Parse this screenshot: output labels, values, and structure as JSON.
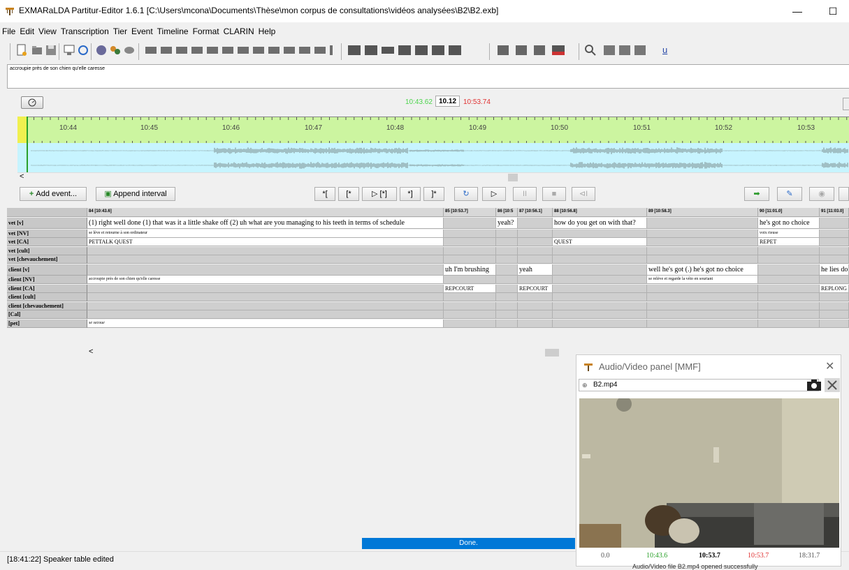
{
  "window": {
    "title": "EXMARaLDA Partitur-Editor 1.6.1 [C:\\Users\\mcona\\Documents\\Thèse\\mon corpus de consultations\\vidéos analysées\\B2\\B2.exb]",
    "minimize": "—",
    "maximize": "☐"
  },
  "menu": [
    "File",
    "Edit",
    "View",
    "Transcription",
    "Tier",
    "Event",
    "Timeline",
    "Format",
    "CLARIN",
    "Help"
  ],
  "description_text": "accroupie près de son chien qu'elle caresse",
  "time": {
    "start": "10:43.62",
    "duration": "10.12",
    "end": "10:53.74"
  },
  "ticks": [
    "10:44",
    "10:45",
    "10:46",
    "10:47",
    "10:48",
    "10:49",
    "10:50",
    "10:51",
    "10:52",
    "10:53"
  ],
  "controls": {
    "add_event": "Add event...",
    "append_interval": "Append interval",
    "play_buttons": [
      "*[",
      "[*",
      "▷ [*]",
      "*]",
      "]*",
      "↻",
      "▷",
      "II",
      "■",
      "⊲I"
    ]
  },
  "columns": [
    {
      "label": "84 [10:43.6]"
    },
    {
      "label": "85 [10:53.7]"
    },
    {
      "label": "86 [10:5"
    },
    {
      "label": "87 [10:56.1]"
    },
    {
      "label": "88 [10:56.8]"
    },
    {
      "label": "89 [10:58.3]"
    },
    {
      "label": "90 [11:01.0]"
    },
    {
      "label": "91 [11:03.0]"
    }
  ],
  "tiers": [
    {
      "label": "vet [v]",
      "cells": [
        "(1) right well done (1) that was it a little shake off (2) uh what are you managing to his teeth in terms of schedule",
        "",
        "yeah?",
        "",
        "how do you get on with that?",
        "",
        "he's got no choice",
        ""
      ]
    },
    {
      "label": "vet [NV]",
      "cells": [
        "se lève et retourne à son ordinateur",
        "",
        "",
        "",
        "",
        "",
        "voix rieuse",
        ""
      ]
    },
    {
      "label": "vet [CA]",
      "cells": [
        "PETTALK    QUEST",
        "",
        "",
        "",
        "QUEST",
        "",
        "REPET",
        ""
      ]
    },
    {
      "label": "vet [cult]",
      "cells": [
        "",
        "",
        "",
        "",
        "",
        "",
        "",
        ""
      ]
    },
    {
      "label": "vet [chevauchement]",
      "cells": [
        "",
        "",
        "",
        "",
        "",
        "",
        "",
        ""
      ]
    },
    {
      "label": "client [v]",
      "cells": [
        "",
        "uh I'm brushing",
        "",
        "yeah",
        "",
        "well he's got (.) he's got no choice",
        "",
        "he lies do"
      ]
    },
    {
      "label": "client [NV]",
      "cells": [
        "accroupie près de son chien qu'elle caresse",
        "",
        "",
        "",
        "",
        "se relève et regarde la véto en souriant",
        "",
        ""
      ]
    },
    {
      "label": "client [CA]",
      "cells": [
        "",
        "REPCOURT",
        "",
        "REPCOURT",
        "",
        "",
        "",
        "REPLONG"
      ]
    },
    {
      "label": "client [cult]",
      "cells": [
        "",
        "",
        "",
        "",
        "",
        "",
        "",
        ""
      ]
    },
    {
      "label": "client [chevauchement]",
      "cells": [
        "",
        "",
        "",
        "",
        "",
        "",
        "",
        ""
      ]
    },
    {
      "label": "[Cal]",
      "cells": [
        "",
        "",
        "",
        "",
        "",
        "",
        "",
        ""
      ]
    },
    {
      "label": "[pet]",
      "cells": [
        "se secoue",
        "",
        "",
        "",
        "",
        "",
        "",
        ""
      ]
    }
  ],
  "scroll_arrow": "<",
  "progress_text": "Done.",
  "status_text": "[18:41:22] Speaker table edited",
  "av_panel": {
    "title": "Audio/Video panel [MMF]",
    "close": "✕",
    "file": "B2.mp4",
    "times": [
      "0.0",
      "10:43.6",
      "10:53.7",
      "10:53.7",
      "18:31.7"
    ],
    "message": "Audio/Video file B2.mp4 opened successfully"
  },
  "colors": {
    "start_time": "#4cd44c",
    "end_time": "#e03030",
    "timeline_bg": "#ccf5a0",
    "wave_bg": "#c7f4ff",
    "progress": "#0078d7"
  }
}
